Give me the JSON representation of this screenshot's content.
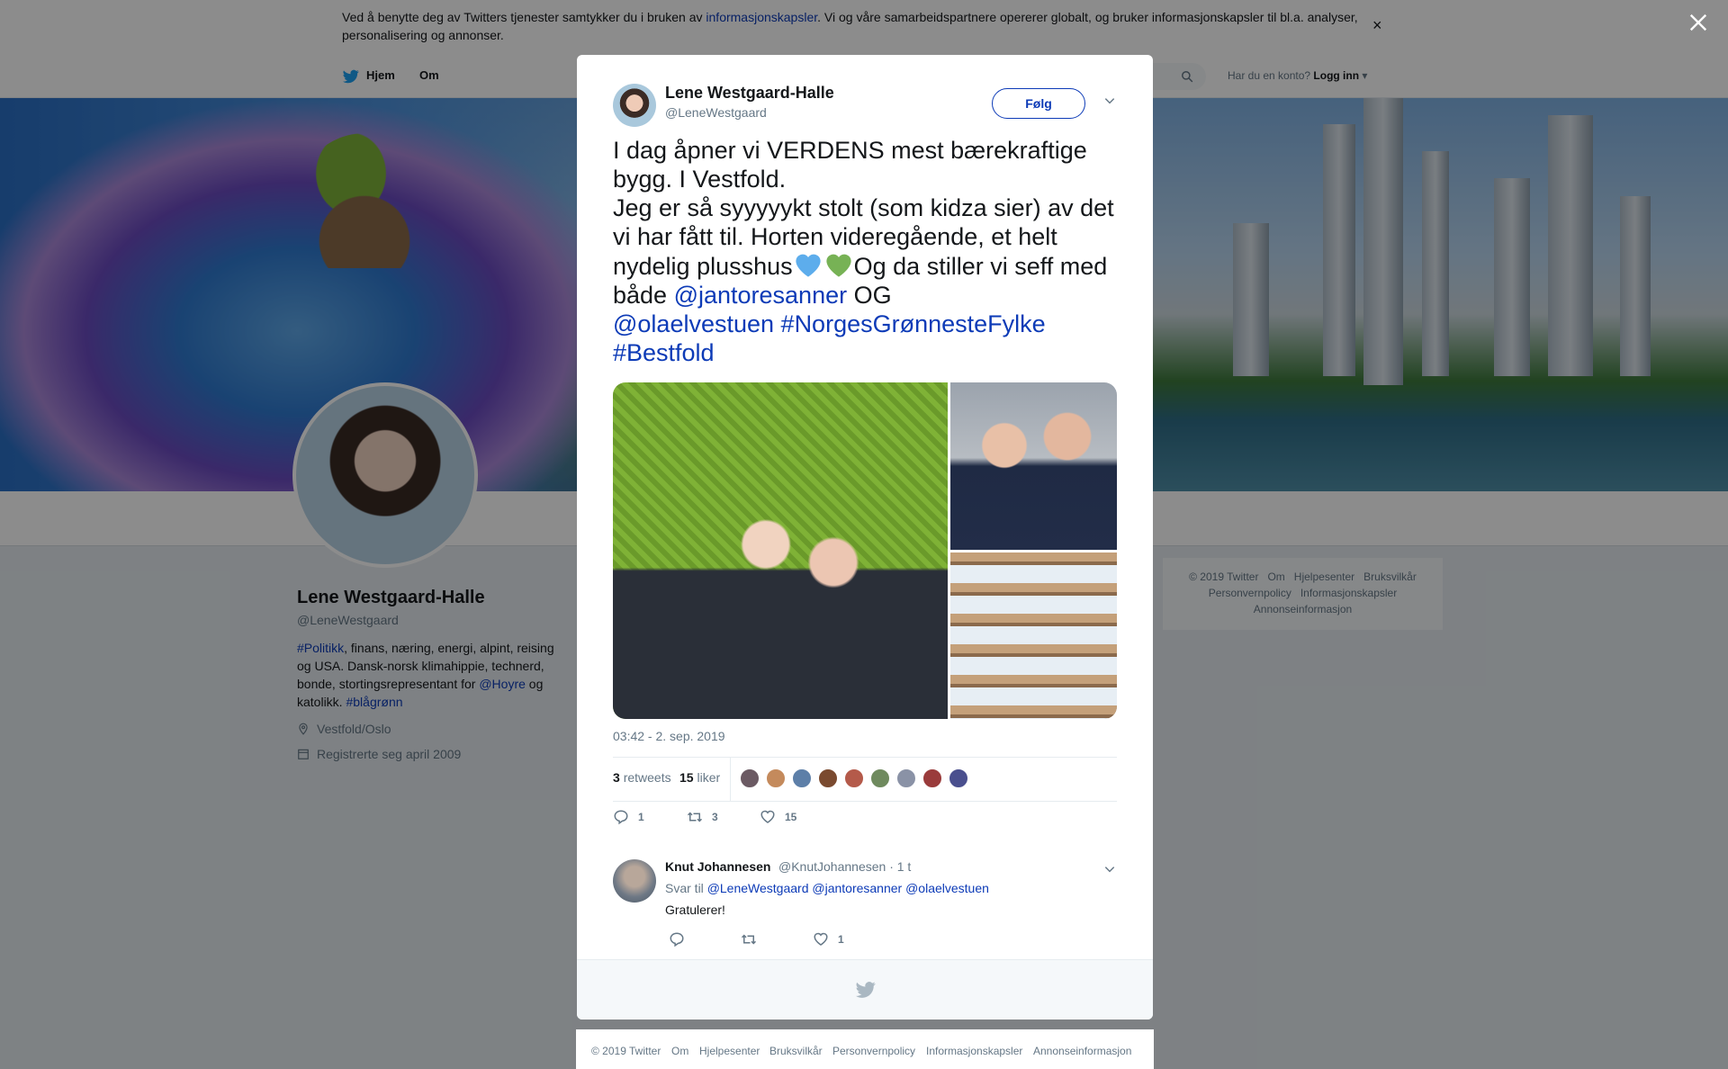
{
  "cookie_banner": {
    "text_before": "Ved å benytte deg av Twitters tjenester samtykker du i bruken av ",
    "link": "informasjonskapsler",
    "text_after": ". Vi og våre samarbeidspartnere opererer globalt, og bruker informasjonskapsler til bl.a. analyser, personalisering og annonser.",
    "close": "×"
  },
  "nav": {
    "home": "Hjem",
    "about": "Om",
    "account_prompt": "Har du en konto?",
    "login": "Logg inn"
  },
  "profile": {
    "name": "Lene Westgaard-Halle",
    "handle": "@LeneWestgaard",
    "bio_hashtag_politikk": "#Politikk",
    "bio_text1": ", finans, næring, energi, alpint, reising og USA. Dansk-norsk klimahippie, technerd, bonde, stortingsrepresentant for ",
    "bio_mention": "@Hoyre",
    "bio_text2": " og katolikk. ",
    "bio_hashtag_blagronn": "#blågrønn",
    "location": "Vestfold/Oslo",
    "joined": "Registrerte seg april 2009"
  },
  "side_footer": [
    "© 2019 Twitter",
    "Om",
    "Hjelpesenter",
    "Bruksvilkår",
    "Personvernpolicy",
    "Informasjonskapsler",
    "Annonseinformasjon"
  ],
  "tweet": {
    "author_name": "Lene Westgaard-Halle",
    "author_handle": "@LeneWestgaard",
    "follow_label": "Følg",
    "caret": "⌄",
    "text_line1": "I dag åpner vi VERDENS mest bærekraftige bygg. I Vestfold.",
    "text_line2": "Jeg er så syyyyykt stolt (som kidza sier) av det vi har fått til. Horten videregående, et helt nydelig plusshus",
    "text_line3": "Og da stiller vi seff med både ",
    "mention1": "@jantoresanner",
    "text_og": " OG",
    "mention2": "@olaelvestuen",
    "hashtag1": "#NorgesGrønnesteFylke",
    "hashtag2": "#Bestfold",
    "timestamp": "03:42 - 2. sep. 2019",
    "retweets_count": "3",
    "retweets_label": "retweets",
    "likes_count": "15",
    "likes_label": "liker",
    "reply_count": "1",
    "retweet_action_count": "3",
    "like_action_count": "15"
  },
  "reply": {
    "name": "Knut Johannesen",
    "handle": "@KnutJohannesen · 1 t",
    "reply_to_prefix": "Svar til ",
    "reply_to_mentions": "@LeneWestgaard @jantoresanner @olaelvestuen",
    "text": "Gratulerer!",
    "like_count": "1"
  },
  "bottom_footer": [
    "© 2019 Twitter",
    "Om",
    "Hjelpesenter",
    "Bruksvilkår",
    "Personvernpolicy",
    "Informasjonskapsler",
    "Annonseinformasjon"
  ],
  "colors": {
    "link": "#0d3bb7",
    "muted": "#657786",
    "heart_blue": "#5dadec",
    "heart_green": "#77b255"
  },
  "icons": [
    "twitter-bird-icon",
    "search-icon",
    "location-icon",
    "calendar-icon",
    "reply-icon",
    "retweet-icon",
    "like-icon",
    "close-icon",
    "chevron-down-icon"
  ]
}
